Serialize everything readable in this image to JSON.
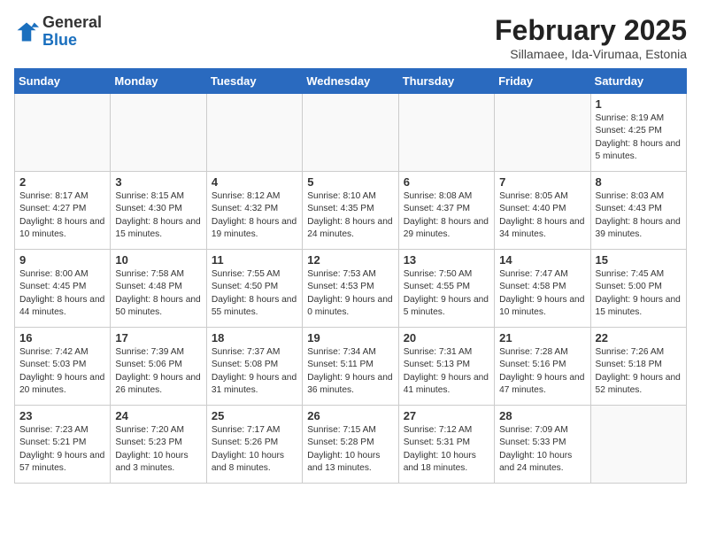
{
  "header": {
    "logo_general": "General",
    "logo_blue": "Blue",
    "month_year": "February 2025",
    "location": "Sillamaee, Ida-Virumaa, Estonia"
  },
  "weekdays": [
    "Sunday",
    "Monday",
    "Tuesday",
    "Wednesday",
    "Thursday",
    "Friday",
    "Saturday"
  ],
  "weeks": [
    [
      {
        "day": "",
        "info": ""
      },
      {
        "day": "",
        "info": ""
      },
      {
        "day": "",
        "info": ""
      },
      {
        "day": "",
        "info": ""
      },
      {
        "day": "",
        "info": ""
      },
      {
        "day": "",
        "info": ""
      },
      {
        "day": "1",
        "info": "Sunrise: 8:19 AM\nSunset: 4:25 PM\nDaylight: 8 hours and 5 minutes."
      }
    ],
    [
      {
        "day": "2",
        "info": "Sunrise: 8:17 AM\nSunset: 4:27 PM\nDaylight: 8 hours and 10 minutes."
      },
      {
        "day": "3",
        "info": "Sunrise: 8:15 AM\nSunset: 4:30 PM\nDaylight: 8 hours and 15 minutes."
      },
      {
        "day": "4",
        "info": "Sunrise: 8:12 AM\nSunset: 4:32 PM\nDaylight: 8 hours and 19 minutes."
      },
      {
        "day": "5",
        "info": "Sunrise: 8:10 AM\nSunset: 4:35 PM\nDaylight: 8 hours and 24 minutes."
      },
      {
        "day": "6",
        "info": "Sunrise: 8:08 AM\nSunset: 4:37 PM\nDaylight: 8 hours and 29 minutes."
      },
      {
        "day": "7",
        "info": "Sunrise: 8:05 AM\nSunset: 4:40 PM\nDaylight: 8 hours and 34 minutes."
      },
      {
        "day": "8",
        "info": "Sunrise: 8:03 AM\nSunset: 4:43 PM\nDaylight: 8 hours and 39 minutes."
      }
    ],
    [
      {
        "day": "9",
        "info": "Sunrise: 8:00 AM\nSunset: 4:45 PM\nDaylight: 8 hours and 44 minutes."
      },
      {
        "day": "10",
        "info": "Sunrise: 7:58 AM\nSunset: 4:48 PM\nDaylight: 8 hours and 50 minutes."
      },
      {
        "day": "11",
        "info": "Sunrise: 7:55 AM\nSunset: 4:50 PM\nDaylight: 8 hours and 55 minutes."
      },
      {
        "day": "12",
        "info": "Sunrise: 7:53 AM\nSunset: 4:53 PM\nDaylight: 9 hours and 0 minutes."
      },
      {
        "day": "13",
        "info": "Sunrise: 7:50 AM\nSunset: 4:55 PM\nDaylight: 9 hours and 5 minutes."
      },
      {
        "day": "14",
        "info": "Sunrise: 7:47 AM\nSunset: 4:58 PM\nDaylight: 9 hours and 10 minutes."
      },
      {
        "day": "15",
        "info": "Sunrise: 7:45 AM\nSunset: 5:00 PM\nDaylight: 9 hours and 15 minutes."
      }
    ],
    [
      {
        "day": "16",
        "info": "Sunrise: 7:42 AM\nSunset: 5:03 PM\nDaylight: 9 hours and 20 minutes."
      },
      {
        "day": "17",
        "info": "Sunrise: 7:39 AM\nSunset: 5:06 PM\nDaylight: 9 hours and 26 minutes."
      },
      {
        "day": "18",
        "info": "Sunrise: 7:37 AM\nSunset: 5:08 PM\nDaylight: 9 hours and 31 minutes."
      },
      {
        "day": "19",
        "info": "Sunrise: 7:34 AM\nSunset: 5:11 PM\nDaylight: 9 hours and 36 minutes."
      },
      {
        "day": "20",
        "info": "Sunrise: 7:31 AM\nSunset: 5:13 PM\nDaylight: 9 hours and 41 minutes."
      },
      {
        "day": "21",
        "info": "Sunrise: 7:28 AM\nSunset: 5:16 PM\nDaylight: 9 hours and 47 minutes."
      },
      {
        "day": "22",
        "info": "Sunrise: 7:26 AM\nSunset: 5:18 PM\nDaylight: 9 hours and 52 minutes."
      }
    ],
    [
      {
        "day": "23",
        "info": "Sunrise: 7:23 AM\nSunset: 5:21 PM\nDaylight: 9 hours and 57 minutes."
      },
      {
        "day": "24",
        "info": "Sunrise: 7:20 AM\nSunset: 5:23 PM\nDaylight: 10 hours and 3 minutes."
      },
      {
        "day": "25",
        "info": "Sunrise: 7:17 AM\nSunset: 5:26 PM\nDaylight: 10 hours and 8 minutes."
      },
      {
        "day": "26",
        "info": "Sunrise: 7:15 AM\nSunset: 5:28 PM\nDaylight: 10 hours and 13 minutes."
      },
      {
        "day": "27",
        "info": "Sunrise: 7:12 AM\nSunset: 5:31 PM\nDaylight: 10 hours and 18 minutes."
      },
      {
        "day": "28",
        "info": "Sunrise: 7:09 AM\nSunset: 5:33 PM\nDaylight: 10 hours and 24 minutes."
      },
      {
        "day": "",
        "info": ""
      }
    ]
  ]
}
